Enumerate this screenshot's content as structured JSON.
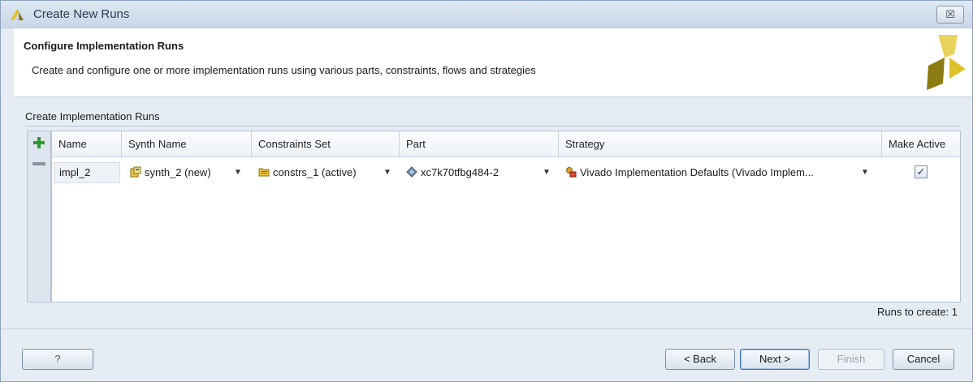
{
  "window": {
    "title": "Create New Runs",
    "close_label": "☒"
  },
  "header": {
    "title": "Configure Implementation Runs",
    "description": "Create and configure one or more implementation runs using various parts, constraints, flows and strategies"
  },
  "section": {
    "label": "Create Implementation Runs"
  },
  "table": {
    "columns": [
      "Name",
      "Synth Name",
      "Constraints Set",
      "Part",
      "Strategy",
      "Make Active"
    ],
    "rows": [
      {
        "name": "impl_2",
        "synth_name": "synth_2 (new)",
        "constraints_set": "constrs_1 (active)",
        "part": "xc7k70tfbg484-2",
        "strategy": "Vivado Implementation Defaults (Vivado Implem...",
        "make_active": true,
        "make_active_mark": "✓"
      }
    ]
  },
  "runs_to_create": "Runs to create: 1",
  "buttons": {
    "help": "?",
    "back": "< Back",
    "next": "Next >",
    "finish": "Finish",
    "cancel": "Cancel"
  },
  "colors": {
    "accent": "#3b73b9",
    "add_green": "#2e9b2e",
    "brand_yellow": "#e0c12a",
    "brand_dark": "#8c7a12"
  },
  "icons": [
    "app-logo-icon",
    "close-icon",
    "add-icon",
    "remove-icon",
    "synth-run-icon",
    "folder-icon",
    "chip-icon",
    "strategy-icon",
    "brand-logo-icon",
    "dropdown-caret-icon",
    "checkbox-icon"
  ]
}
